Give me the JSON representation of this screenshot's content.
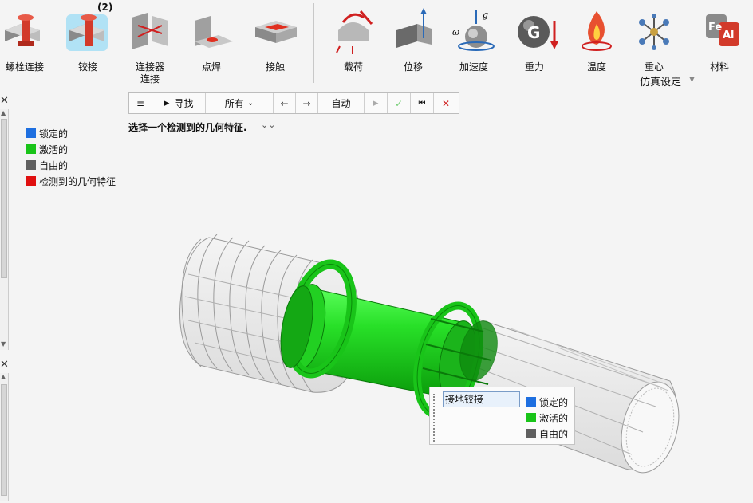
{
  "ribbon": {
    "items": [
      {
        "label": "螺栓连接",
        "icon": "bolt-connection-icon"
      },
      {
        "label": "铰接",
        "icon": "hinge-icon",
        "badge": "(2)"
      },
      {
        "label": "连接器\n连接",
        "icon": "connector-icon"
      },
      {
        "label": "点焊",
        "icon": "spot-weld-icon"
      },
      {
        "label": "接触",
        "icon": "contact-icon"
      },
      {
        "label": "载荷",
        "icon": "load-icon"
      },
      {
        "label": "位移",
        "icon": "displacement-icon"
      },
      {
        "label": "加速度",
        "icon": "acceleration-icon",
        "glyph_omega": "ω",
        "glyph_g": "g"
      },
      {
        "label": "重力",
        "icon": "gravity-icon",
        "glyph": "G"
      },
      {
        "label": "温度",
        "icon": "temperature-icon"
      },
      {
        "label": "重心",
        "icon": "center-of-gravity-icon"
      },
      {
        "label": "材料",
        "icon": "material-icon",
        "glyph_fe": "Fe",
        "glyph_al": "Al"
      }
    ],
    "group_label": "仿真设定"
  },
  "legend": {
    "items": [
      {
        "label": "锁定的",
        "color": "#1e6fe0"
      },
      {
        "label": "激活的",
        "color": "#19c419"
      },
      {
        "label": "自由的",
        "color": "#606060"
      },
      {
        "label": "检测到的几何特征",
        "color": "#e01010"
      }
    ]
  },
  "toolbar": {
    "menu": "≡",
    "find": "寻找",
    "filter": "所有",
    "back": "←",
    "forward": "→",
    "mode": "自动",
    "play": "▶",
    "confirm": "✓",
    "reset": "⏮",
    "cancel": "✕"
  },
  "prompt": "选择一个检测到的几何特征.",
  "popup": {
    "selected": "接地铰接",
    "legend": [
      {
        "label": "锁定的",
        "color": "#1e6fe0"
      },
      {
        "label": "激活的",
        "color": "#19c419"
      },
      {
        "label": "自由的",
        "color": "#606060"
      }
    ]
  },
  "colors": {
    "active": "#19c419",
    "locked": "#1e6fe0",
    "free": "#606060",
    "detected": "#e01010"
  }
}
